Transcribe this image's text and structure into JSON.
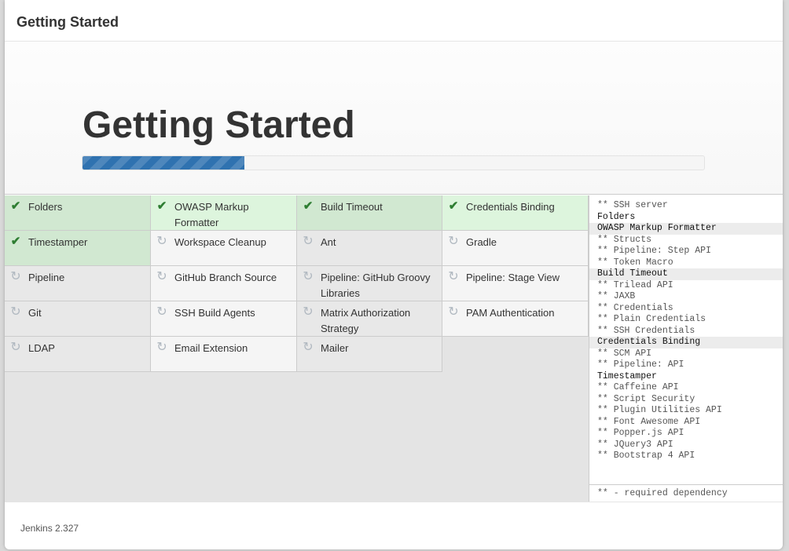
{
  "header": {
    "title": "Getting Started"
  },
  "hero": {
    "title": "Getting Started",
    "progress_fraction": 0.26
  },
  "plugins": [
    {
      "label": "Folders",
      "status": "success"
    },
    {
      "label": "OWASP Markup Formatter",
      "status": "success"
    },
    {
      "label": "Build Timeout",
      "status": "success"
    },
    {
      "label": "Credentials Binding",
      "status": "success"
    },
    {
      "label": "Timestamper",
      "status": "success"
    },
    {
      "label": "Workspace Cleanup",
      "status": "pending"
    },
    {
      "label": "Ant",
      "status": "pending"
    },
    {
      "label": "Gradle",
      "status": "pending"
    },
    {
      "label": "Pipeline",
      "status": "pending"
    },
    {
      "label": "GitHub Branch Source",
      "status": "pending"
    },
    {
      "label": "Pipeline: GitHub Groovy Libraries",
      "status": "pending"
    },
    {
      "label": "Pipeline: Stage View",
      "status": "pending"
    },
    {
      "label": "Git",
      "status": "pending"
    },
    {
      "label": "SSH Build Agents",
      "status": "pending"
    },
    {
      "label": "Matrix Authorization Strategy",
      "status": "pending"
    },
    {
      "label": "PAM Authentication",
      "status": "pending"
    },
    {
      "label": "LDAP",
      "status": "pending"
    },
    {
      "label": "Email Extension",
      "status": "pending"
    },
    {
      "label": "Mailer",
      "status": "pending"
    }
  ],
  "log": {
    "lines": [
      {
        "text": "** SSH server",
        "kind": "dep"
      },
      {
        "text": "Folders",
        "kind": "head"
      },
      {
        "text": "OWASP Markup Formatter",
        "kind": "head"
      },
      {
        "text": "** Structs",
        "kind": "dep"
      },
      {
        "text": "** Pipeline: Step API",
        "kind": "dep"
      },
      {
        "text": "** Token Macro",
        "kind": "dep"
      },
      {
        "text": "Build Timeout",
        "kind": "head"
      },
      {
        "text": "** Trilead API",
        "kind": "dep"
      },
      {
        "text": "** JAXB",
        "kind": "dep"
      },
      {
        "text": "** Credentials",
        "kind": "dep"
      },
      {
        "text": "** Plain Credentials",
        "kind": "dep"
      },
      {
        "text": "** SSH Credentials",
        "kind": "dep"
      },
      {
        "text": "Credentials Binding",
        "kind": "head"
      },
      {
        "text": "** SCM API",
        "kind": "dep"
      },
      {
        "text": "** Pipeline: API",
        "kind": "dep"
      },
      {
        "text": "Timestamper",
        "kind": "head"
      },
      {
        "text": "** Caffeine API",
        "kind": "dep"
      },
      {
        "text": "** Script Security",
        "kind": "dep"
      },
      {
        "text": "** Plugin Utilities API",
        "kind": "dep"
      },
      {
        "text": "** Font Awesome API",
        "kind": "dep"
      },
      {
        "text": "** Popper.js API",
        "kind": "dep"
      },
      {
        "text": "** JQuery3 API",
        "kind": "dep"
      },
      {
        "text": "** Bootstrap 4 API",
        "kind": "dep"
      }
    ],
    "footnote": "** - required dependency"
  },
  "footer": {
    "version": "Jenkins 2.327"
  },
  "icons": {
    "success": "check-icon",
    "pending": "refresh-icon"
  },
  "colors": {
    "progress": "#2f72b0",
    "success_bg": "#d1e8d1",
    "pending_bg": "#f5f5f5"
  }
}
